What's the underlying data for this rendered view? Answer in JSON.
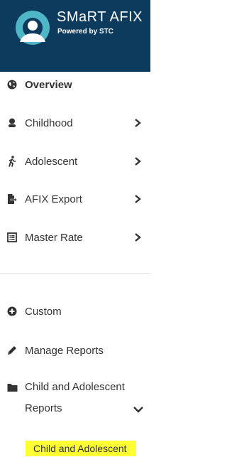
{
  "brand": {
    "title": "SMaRT AFIX",
    "subtitle": "Powered by STC",
    "colors": {
      "header_bg": "#0d3b5e",
      "logo_teal": "#4fb6c8",
      "highlight": "#ffff33"
    }
  },
  "nav": {
    "overview": {
      "label": "Overview",
      "icon": "globe-icon"
    },
    "childhood": {
      "label": "Childhood",
      "icon": "child-icon"
    },
    "adolescent": {
      "label": "Adolescent",
      "icon": "walking-person-icon"
    },
    "afix_export": {
      "label": "AFIX Export",
      "icon": "file-export-icon"
    },
    "master_rate": {
      "label": "Master Rate",
      "icon": "list-document-icon"
    },
    "custom": {
      "label": "Custom",
      "icon": "plus-circle-icon"
    },
    "manage_reports": {
      "label": "Manage Reports",
      "icon": "pencil-icon"
    },
    "child_adolescent_reports": {
      "label_line1": "Child and Adolescent",
      "label_line2": "Reports",
      "icon": "folder-icon"
    }
  },
  "submenu": {
    "selected_item": "Child and Adolescent"
  }
}
